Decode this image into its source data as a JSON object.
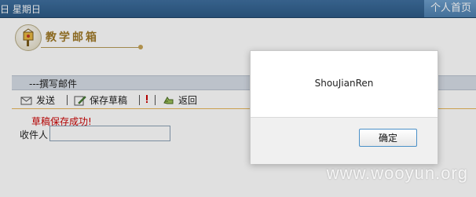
{
  "header": {
    "date_fragment": "日 星期日",
    "right_link": "个人首页"
  },
  "module": {
    "title": "教学邮箱"
  },
  "compose": {
    "title": "---撰写邮件"
  },
  "toolbar": {
    "send_label": "发送",
    "save_draft_label": "保存草稿",
    "back_label": "返回"
  },
  "status": {
    "message": "草稿保存成功!"
  },
  "form": {
    "recipient_label": "收件人",
    "recipient_value": ""
  },
  "dialog": {
    "message": "ShouJianRen",
    "ok_label": "确定"
  },
  "watermark": {
    "text": "www.wooyun.org"
  },
  "colors": {
    "header_bg": "#2d5b86",
    "status_text": "#cc0000",
    "accent_gold": "#a07a2a"
  }
}
